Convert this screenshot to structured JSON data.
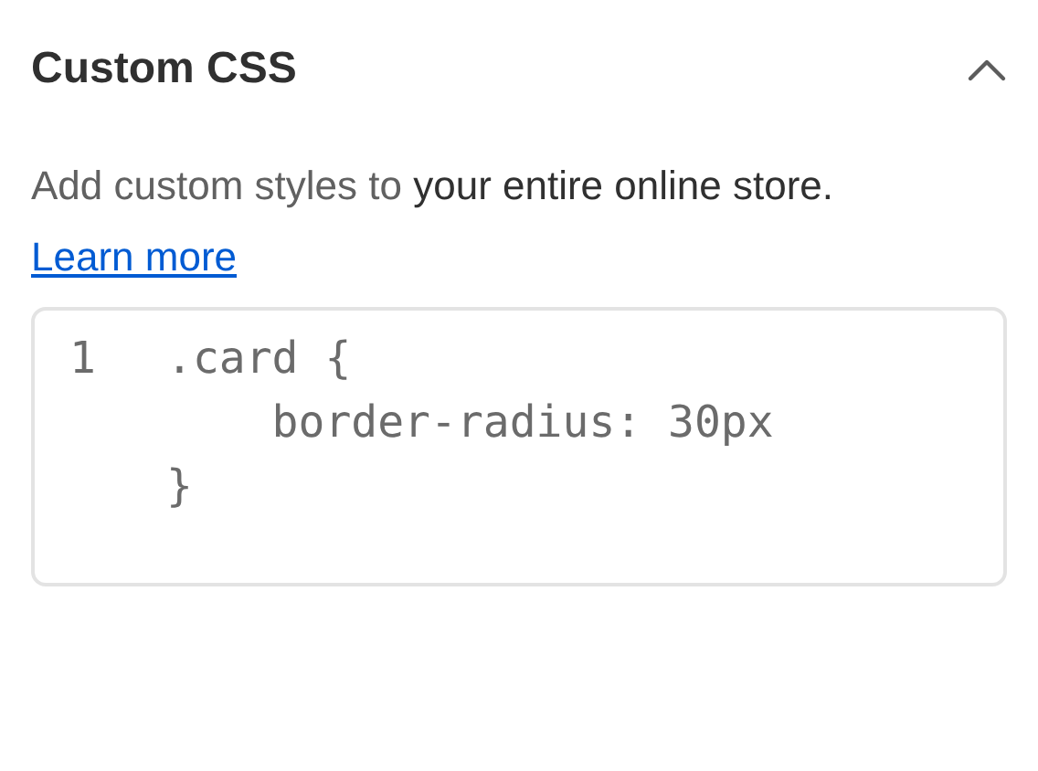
{
  "section": {
    "title": "Custom CSS",
    "expanded": true,
    "description": "Add custom styles to **your entire online store.**",
    "link": "Learn more",
    "code_lines": [
      {
        "number": "1",
        "text": ".card {"
      },
      {
        "text": "    border-radius: 30px"
      },
      {
        "text": "}"
      }
    ]
  }
}
